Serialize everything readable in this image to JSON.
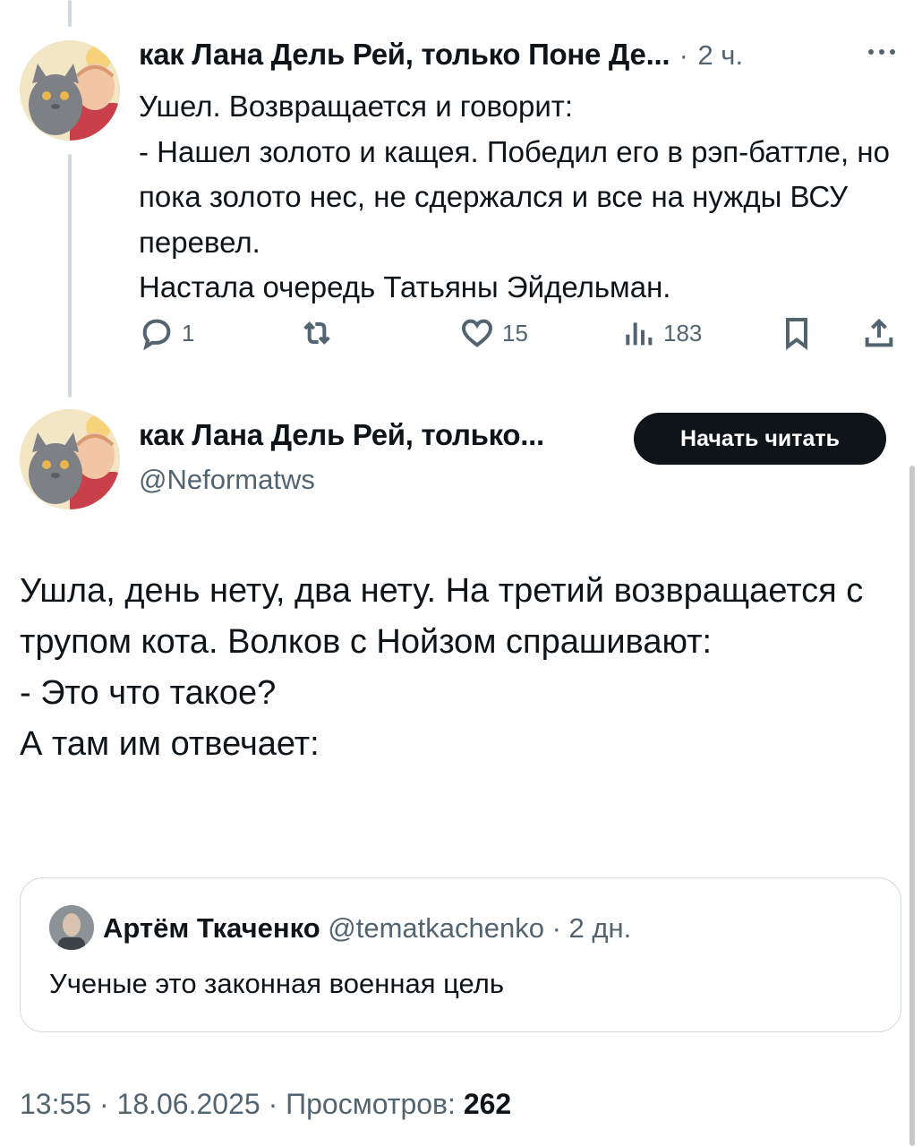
{
  "tweet1": {
    "author_name": "как Лана Дель Рей, только Поне Де...",
    "separator": "·",
    "time": "2 ч.",
    "text": "Ушел. Возвращается и говорит:\n- Нашел золото и кащея. Победил его в рэп-баттле, но пока золото нес, не сдержался и все на нужды ВСУ перевел.\nНастала очередь Татьяны Эйдельман.",
    "replies": "1",
    "retweets": "",
    "likes": "15",
    "views": "183"
  },
  "tweet2": {
    "author_name": "как Лана Дель Рей, только...",
    "handle": "@Neformatws",
    "follow_label": "Начать читать",
    "text": "Ушла, день нету, два нету. На третий возвращается с трупом кота. Волков с Нойзом спрашивают:\n- Это что такое?\nА там им отвечает:",
    "quote": {
      "author_name": "Артём Ткаченко",
      "handle": "@tematkachenko",
      "separator": "·",
      "time": "2 дн.",
      "text": "Ученые это законная военная цель"
    },
    "footer": {
      "time": "13:55",
      "sep1": "·",
      "date": "18.06.2025",
      "sep2": "·",
      "views_label": "Просмотров:",
      "views_count": "262"
    }
  },
  "icons": [
    "more-icon",
    "reply-icon",
    "retweet-icon",
    "like-icon",
    "views-icon",
    "bookmark-icon",
    "share-icon"
  ],
  "colors": {
    "text": "#0f1419",
    "muted": "#536471",
    "border": "#cfd9de",
    "button": "#0f1419"
  }
}
